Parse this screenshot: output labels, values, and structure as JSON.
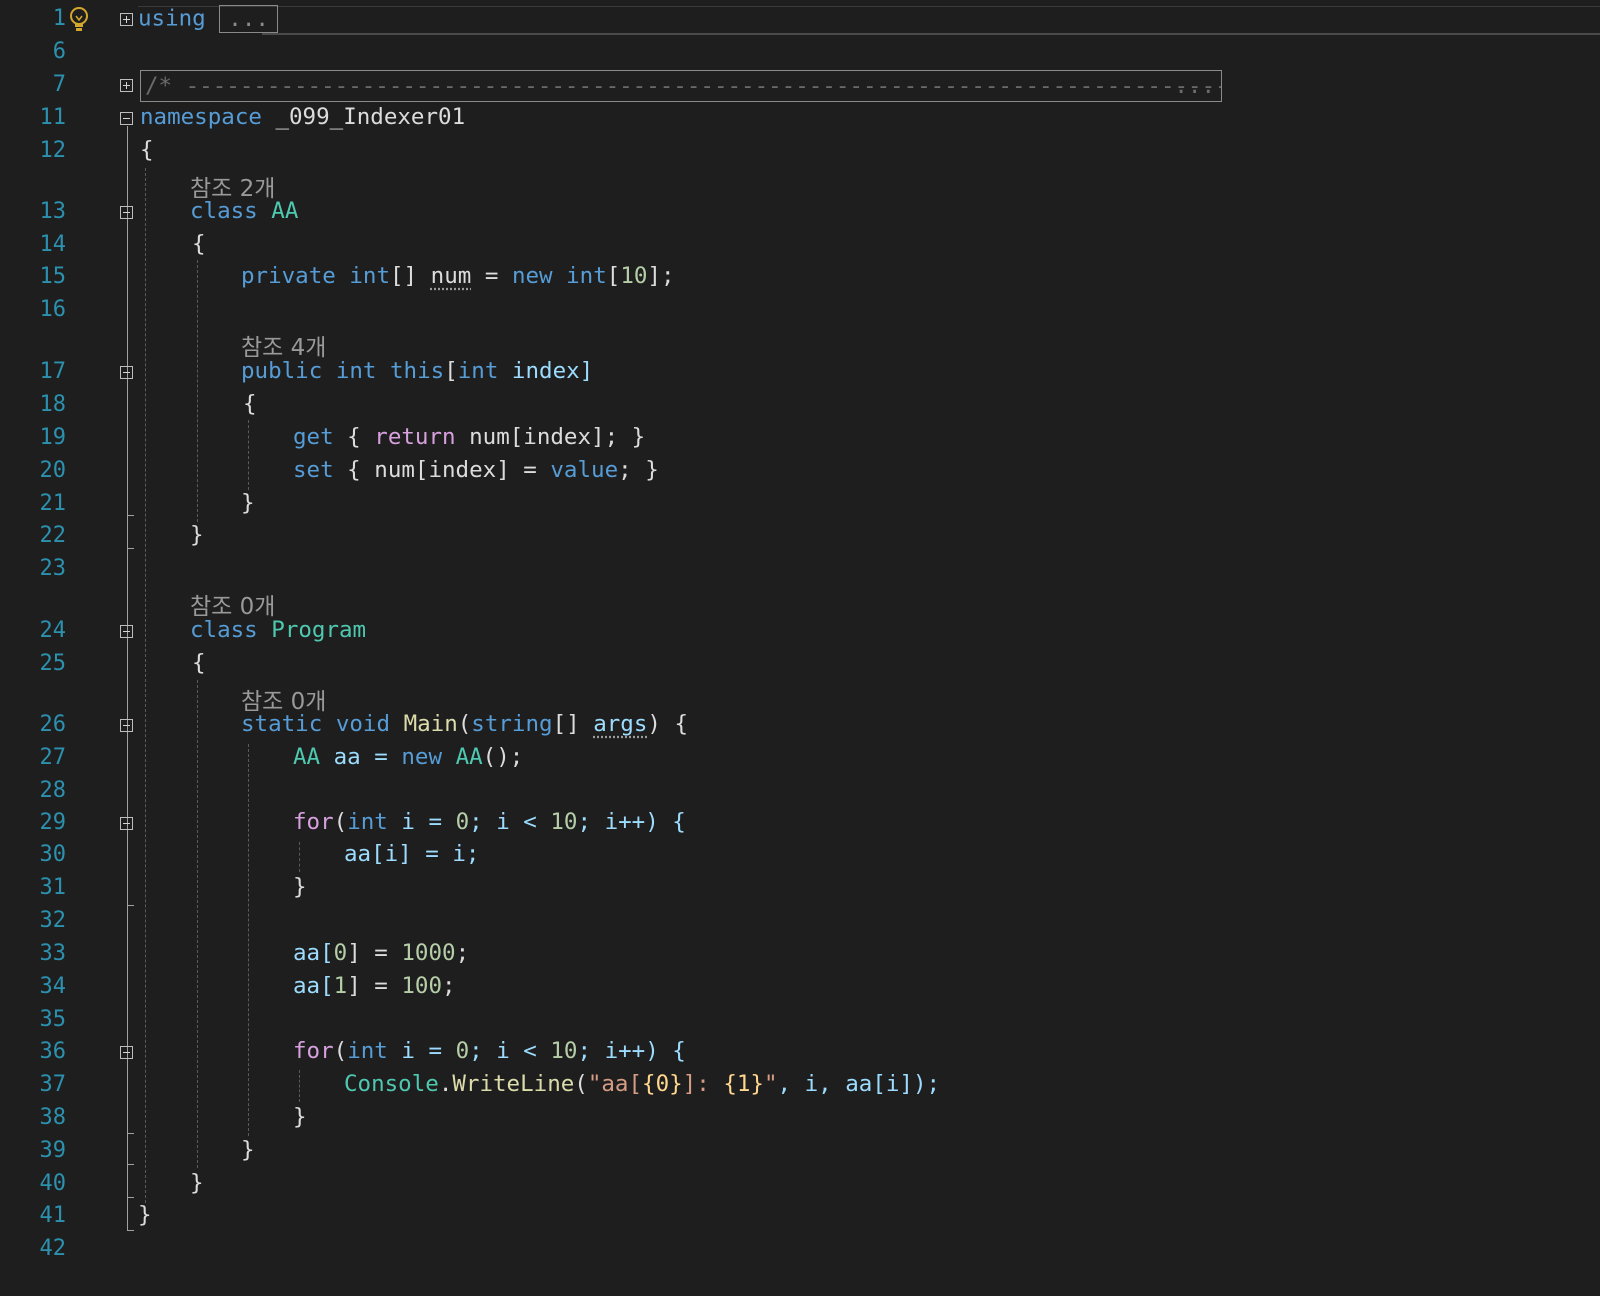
{
  "editor": {
    "lines": [
      {
        "n": "1",
        "text": "using",
        "collapsed": "..."
      },
      {
        "n": "6"
      },
      {
        "n": "7",
        "comment": "/* ------------------------------------------------------------------------------------------------------------------------",
        "ellipsis": "..."
      },
      {
        "n": "11",
        "pre": "namespace",
        "name": "_099_Indexer01"
      },
      {
        "n": "12",
        "text": "{"
      },
      {
        "lens": "참조 2개"
      },
      {
        "n": "13",
        "pre": "class",
        "name": "AA"
      },
      {
        "n": "14",
        "text": "{"
      },
      {
        "n": "15",
        "t1": "private",
        "t2": "int",
        "t3": "[] ",
        "t4": "num",
        "t5": " = ",
        "t6": "new",
        "t7": " ",
        "t8": "int",
        "t9": "[",
        "t10": "10",
        "t11": "];"
      },
      {
        "n": "16"
      },
      {
        "lens": "참조 4개"
      },
      {
        "n": "17",
        "t1": "public",
        "t2": "int",
        "t3": "this",
        "t4": "[",
        "t5": "int",
        "t6": " index]"
      },
      {
        "n": "18",
        "text": "{"
      },
      {
        "n": "19",
        "t1": "get",
        "t2": " { ",
        "t3": "return",
        "t4": " num[index]; }"
      },
      {
        "n": "20",
        "t1": "set",
        "t2": " { num[index] = ",
        "t3": "value",
        "t4": "; }"
      },
      {
        "n": "21",
        "text": "}"
      },
      {
        "n": "22",
        "text": "}"
      },
      {
        "n": "23"
      },
      {
        "lens": "참조 0개"
      },
      {
        "n": "24",
        "pre": "class",
        "name": "Program"
      },
      {
        "n": "25",
        "text": "{"
      },
      {
        "lens": "참조 0개"
      },
      {
        "n": "26",
        "t1": "static",
        "t2": "void",
        "t3": "Main",
        "t4": "(",
        "t5": "string",
        "t6": "[] ",
        "t7": "args",
        "t8": ") {"
      },
      {
        "n": "27",
        "t1": "AA",
        "t2": " aa = ",
        "t3": "new",
        "t4": " ",
        "t5": "AA",
        "t6": "();"
      },
      {
        "n": "28"
      },
      {
        "n": "29",
        "t1": "for",
        "t2": "(",
        "t3": "int",
        "t4": " i = ",
        "t5": "0",
        "t6": "; i < ",
        "t7": "10",
        "t8": "; i++) {"
      },
      {
        "n": "30",
        "text": "aa[i] = i;"
      },
      {
        "n": "31",
        "text": "}"
      },
      {
        "n": "32"
      },
      {
        "n": "33",
        "t1": "aa[",
        "t2": "0",
        "t3": "] = ",
        "t4": "1000",
        "t5": ";"
      },
      {
        "n": "34",
        "t1": "aa[",
        "t2": "1",
        "t3": "] = ",
        "t4": "100",
        "t5": ";"
      },
      {
        "n": "35"
      },
      {
        "n": "36",
        "t1": "for",
        "t2": "(",
        "t3": "int",
        "t4": " i = ",
        "t5": "0",
        "t6": "; i < ",
        "t7": "10",
        "t8": "; i++) {"
      },
      {
        "n": "37",
        "t1": "Console",
        "t2": ".",
        "t3": "WriteLine",
        "t4": "(",
        "t5": "\"aa[",
        "t6": "{0}",
        "t7": "]: ",
        "t8": "{1}",
        "t9": "\"",
        "t10": ", i, aa[i]);"
      },
      {
        "n": "38",
        "text": "}"
      },
      {
        "n": "39",
        "text": "}"
      },
      {
        "n": "40",
        "text": "}"
      },
      {
        "n": "41",
        "text": "}"
      },
      {
        "n": "42"
      }
    ]
  },
  "icons": {
    "lightbulb": "lightbulb-icon",
    "expand": "expand-icon",
    "collapse": "collapse-icon"
  },
  "colors": {
    "background": "#1e1e1e",
    "line_number": "#2b91af",
    "keyword": "#569cd6",
    "control_keyword": "#d8a0df",
    "type": "#4ec9b0",
    "method": "#dcdcaa",
    "number": "#b5cea8",
    "string": "#d69d85",
    "codelens": "#999999"
  }
}
